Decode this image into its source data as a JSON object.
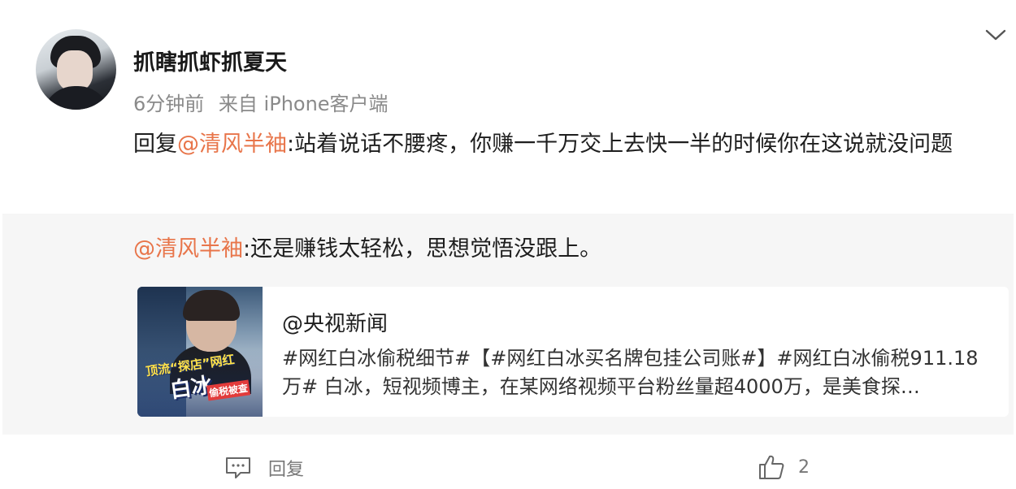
{
  "post": {
    "username": "抓瞎抓虾抓夏天",
    "time": "6分钟前",
    "source": "来自 iPhone客户端",
    "reply_prefix": "回复",
    "reply_mention": "@清风半袖",
    "reply_body": ":站着说话不腰疼，你赚一千万交上去快一半的时候你在这说就没问题"
  },
  "quoted": {
    "mention": "@清风半袖",
    "body": ":还是赚钱太轻松，思想觉悟没跟上。",
    "card": {
      "author": "@央视新闻",
      "description": "#网红白冰偷税细节#【#网红白冰买名牌包挂公司账#】#网红白冰偷税911.18万# 白冰，短视频博主，在某网络视频平台粉丝量超4000万，是美食探…",
      "thumb_caption_top": "顶流“探店”网红",
      "thumb_caption_main": "白冰",
      "thumb_caption_tag": "偷税被查"
    }
  },
  "footer": {
    "reply_label": "回复",
    "like_count": "2"
  },
  "icons": {
    "more": "chevron-down-icon",
    "reply": "comment-icon",
    "like": "thumbs-up-icon"
  },
  "colors": {
    "mention": "#e8754a",
    "quote_bg": "#f6f6f6"
  }
}
